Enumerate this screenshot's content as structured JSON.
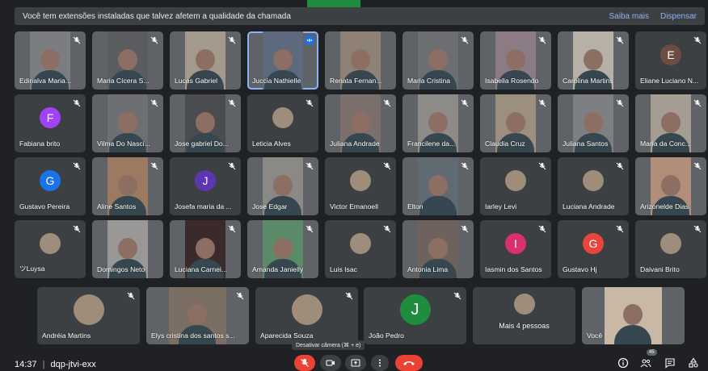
{
  "banner": {
    "message": "Você tem extensões instaladas que talvez afetem a qualidade da chamada",
    "learn_more": "Saiba mais",
    "dismiss": "Dispensar"
  },
  "participants": [
    {
      "name": "Edinalva Maria...",
      "type": "video",
      "bg": "#7b7d80",
      "muted": true
    },
    {
      "name": "Maria Cícera S...",
      "type": "video",
      "bg": "#5a5c60",
      "muted": true
    },
    {
      "name": "Lucas Gabriel",
      "type": "video",
      "bg": "#a49a8c",
      "muted": true
    },
    {
      "name": "Juccia Nathielle",
      "type": "video",
      "bg": "#5d6a7e",
      "muted": false,
      "speaking": true
    },
    {
      "name": "Renata Fernan...",
      "type": "video",
      "bg": "#8d8275",
      "muted": false
    },
    {
      "name": "Maria Cristina",
      "type": "video",
      "bg": "#6c6e72",
      "muted": true
    },
    {
      "name": "Isabella Rosendo",
      "type": "video",
      "bg": "#8b7b85",
      "muted": true
    },
    {
      "name": "Carolina Martins",
      "type": "video",
      "bg": "#b7b0a6",
      "muted": true
    },
    {
      "name": "Eliane Luciano N...",
      "type": "avatar",
      "initial": "E",
      "avatar_color": "#6d4c41",
      "muted": true
    },
    {
      "name": "Fabiana brito",
      "type": "avatar",
      "initial": "F",
      "avatar_color": "#a142f4",
      "muted": true
    },
    {
      "name": "Vilma Do Nasci...",
      "type": "video",
      "bg": "#6e6f72",
      "muted": true
    },
    {
      "name": "Jose gabriel Do...",
      "type": "video",
      "bg": "#4a4c50",
      "muted": true
    },
    {
      "name": "Leticia Alves",
      "type": "photo",
      "muted": true
    },
    {
      "name": "Juliana Andrade",
      "type": "video",
      "bg": "#7a6f6a",
      "muted": true
    },
    {
      "name": "Francilene da...",
      "type": "video",
      "bg": "#8c8b87",
      "muted": true
    },
    {
      "name": "Claudia Cruz",
      "type": "video",
      "bg": "#9d8f7d",
      "muted": true
    },
    {
      "name": "Juliana Santos",
      "type": "video",
      "bg": "#7d7f82",
      "muted": true
    },
    {
      "name": "Maria da Conc...",
      "type": "video",
      "bg": "#a59d93",
      "muted": true
    },
    {
      "name": "Gustavo Pereira",
      "type": "avatar",
      "initial": "G",
      "avatar_color": "#1a73e8",
      "muted": true
    },
    {
      "name": "Aline Santos",
      "type": "video",
      "bg": "#9c7a62",
      "muted": true
    },
    {
      "name": "Josefa maria da ...",
      "type": "avatar",
      "initial": "J",
      "avatar_color": "#5e35b1",
      "muted": true
    },
    {
      "name": "Jose Edgar",
      "type": "video",
      "bg": "#8a8986",
      "muted": true
    },
    {
      "name": "Victor Emanoell",
      "type": "photo",
      "muted": true
    },
    {
      "name": "Elton",
      "type": "video",
      "bg": "#5f6a72",
      "muted": true
    },
    {
      "name": "Iarley Levi",
      "type": "photo",
      "muted": true
    },
    {
      "name": "Luciana Andrade",
      "type": "photo",
      "muted": true
    },
    {
      "name": "Arizonelde Dias",
      "type": "video",
      "bg": "#b08e7a",
      "muted": true
    },
    {
      "name": "ツLuysa",
      "type": "photo",
      "muted": true
    },
    {
      "name": "Domingos Neto",
      "type": "video",
      "bg": "#9a9896",
      "muted": false
    },
    {
      "name": "Luciana Carnei...",
      "type": "video",
      "bg": "#3a2a2c",
      "muted": true
    },
    {
      "name": "Amanda Janielly",
      "type": "video",
      "bg": "#5b8a68",
      "muted": true
    },
    {
      "name": "Luis Isac",
      "type": "photo",
      "muted": true
    },
    {
      "name": "Antonia Lima",
      "type": "video",
      "bg": "#6e625c",
      "muted": true
    },
    {
      "name": "Iasmin dos Santos",
      "type": "avatar",
      "initial": "I",
      "avatar_color": "#d93070",
      "muted": true
    },
    {
      "name": "Gustavo Hj",
      "type": "avatar",
      "initial": "G",
      "avatar_color": "#e8453c",
      "muted": true
    },
    {
      "name": "Daivani Brito",
      "type": "photo",
      "muted": true
    }
  ],
  "last_row": [
    {
      "name": "Andréia Martins",
      "type": "photo",
      "muted": true
    },
    {
      "name": "Elys cristina dos santos s...",
      "type": "video",
      "bg": "#7b6e63",
      "muted": true
    },
    {
      "name": "Aparecida Souza",
      "type": "photo",
      "muted": true
    },
    {
      "name": "João Pedro",
      "type": "avatar",
      "initial": "J",
      "avatar_color": "#1e8e3e",
      "muted": true
    },
    {
      "name": "Mais 4 pessoas",
      "type": "more",
      "muted": false
    },
    {
      "name": "Você",
      "type": "video",
      "bg": "#c9b8a6",
      "muted": false,
      "self": true
    }
  ],
  "bottom": {
    "time": "14:37",
    "separator": "|",
    "meeting_code": "dqp-jtvi-exx",
    "tooltip": "Desativar câmera (⌘ + e)",
    "participant_count": "45"
  },
  "icons": [
    "mic-off-icon",
    "camera-icon",
    "present-icon",
    "more-vert-icon",
    "end-call-icon",
    "info-icon",
    "people-icon",
    "chat-icon",
    "activities-icon"
  ],
  "colors": {
    "end_call": "#ea4335",
    "accent": "#8ab4f8",
    "banner": "#3c4043",
    "tile": "#3c4043"
  }
}
